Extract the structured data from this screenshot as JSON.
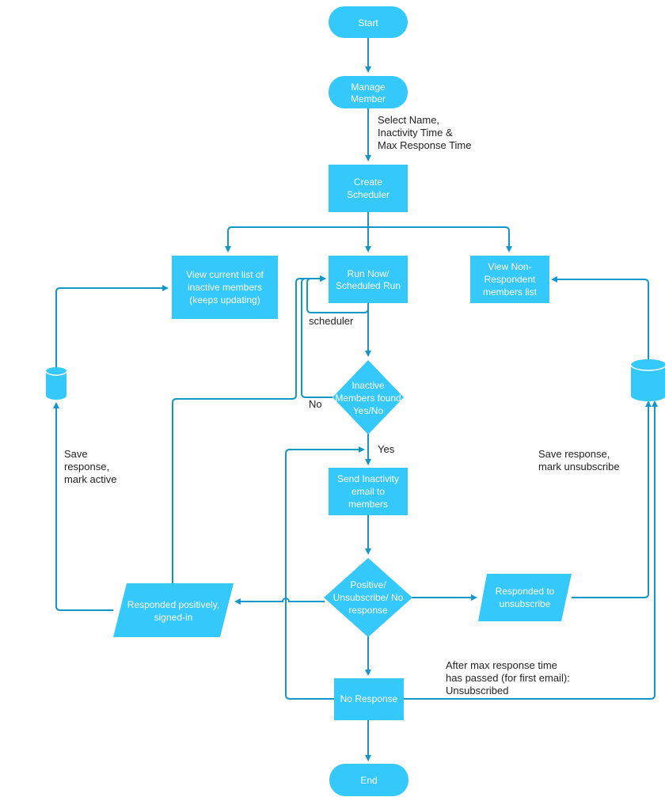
{
  "colors": {
    "node_fill": "#35c8fa",
    "edge": "#1396c8",
    "label_text": "#222222",
    "node_text": "#ffffff"
  },
  "nodes": {
    "start": {
      "type": "terminal",
      "lines": [
        "Start"
      ]
    },
    "manage_member": {
      "type": "terminal",
      "lines": [
        "Manage",
        "Member"
      ]
    },
    "create_scheduler": {
      "type": "process",
      "lines": [
        "Create",
        "Scheduler"
      ]
    },
    "view_inactive": {
      "type": "process",
      "lines": [
        "View current list of",
        "inactive members",
        "(keeps updating)"
      ]
    },
    "run_now": {
      "type": "process",
      "lines": [
        "Run Now/",
        "Scheduled Run"
      ]
    },
    "view_non_respondent": {
      "type": "process",
      "lines": [
        "View Non-",
        "Respondent",
        "members list"
      ]
    },
    "inactive_found": {
      "type": "decision",
      "lines": [
        "Inactive",
        "Members found",
        "Yes/No"
      ]
    },
    "send_email": {
      "type": "process",
      "lines": [
        "Send Inactivity",
        "email to",
        "members"
      ]
    },
    "response_decision": {
      "type": "decision",
      "lines": [
        "Positive/",
        "Unsubscribe/ No",
        "response"
      ]
    },
    "responded_positive": {
      "type": "data",
      "lines": [
        "Responded positively,",
        "signed-in"
      ]
    },
    "responded_unsub": {
      "type": "data",
      "lines": [
        "Responded to",
        "unsubscribe"
      ]
    },
    "no_response": {
      "type": "process",
      "lines": [
        "No Response"
      ]
    },
    "end": {
      "type": "terminal",
      "lines": [
        "End"
      ]
    },
    "db_left": {
      "type": "database",
      "lines": []
    },
    "db_right": {
      "type": "database",
      "lines": []
    }
  },
  "edge_labels": {
    "select": [
      "Select Name,",
      "Inactivity Time &",
      "Max Response Time"
    ],
    "scheduler": [
      "scheduler"
    ],
    "no": [
      "No"
    ],
    "yes": [
      "Yes"
    ],
    "save_active": [
      "Save",
      "response,",
      "mark active"
    ],
    "save_unsub": [
      "Save response,",
      "mark unsubscribe"
    ],
    "after_max": [
      "After max response time",
      "has passed (for first email):",
      "Unsubscribed"
    ]
  }
}
